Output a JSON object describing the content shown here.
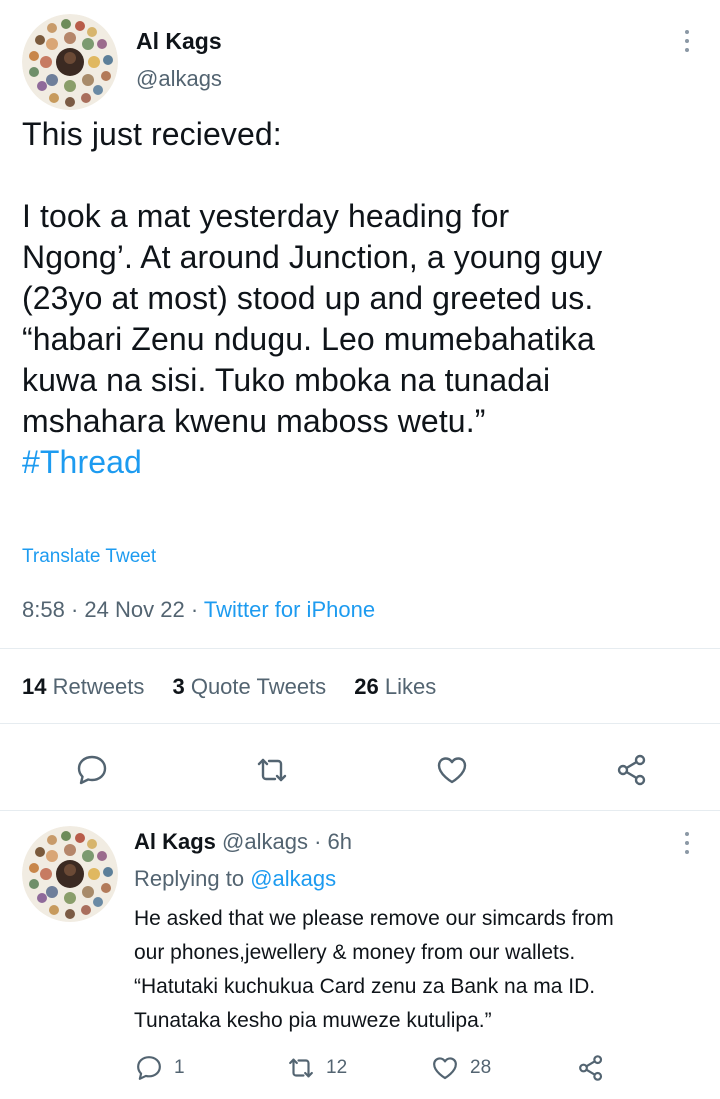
{
  "tweet": {
    "author_name": "Al Kags",
    "author_handle": "@alkags",
    "lines": [
      "This just recieved:",
      "",
      "I took a mat yesterday heading for",
      "Ngong’. At around Junction, a young guy",
      "(23yo at most) stood up and greeted us.",
      "“habari Zenu ndugu. Leo mumebahatika",
      "kuwa na sisi. Tuko mboka na tunadai",
      "mshahara kwenu maboss wetu.”"
    ],
    "hashtag": "#Thread",
    "translate": "Translate Tweet",
    "time": "8:58",
    "date": "24 Nov 22",
    "sep": "·",
    "source": "Twitter for iPhone",
    "stats": {
      "retweets_count": "14",
      "retweets_label": "Retweets",
      "quotes_count": "3",
      "quotes_label": "Quote Tweets",
      "likes_count": "26",
      "likes_label": "Likes"
    }
  },
  "reply": {
    "author_name": "Al Kags",
    "author_handle": "@alkags",
    "age": "· 6h",
    "replying_prefix": "Replying to",
    "replying_to": "@alkags",
    "lines": [
      "He asked that we please remove our simcards from",
      "our phones,jewellery & money from our wallets.",
      "“Hatutaki kuchukua Card zenu za Bank na ma ID.",
      "Tunataka kesho pia muweze kutulipa.”"
    ],
    "reply_count": "1",
    "retweet_count": "12",
    "like_count": "28"
  },
  "colors": {
    "text": "#0f1419",
    "secondary": "#536471",
    "accent": "#1d9bf0",
    "divider": "#e6ecf0"
  },
  "icons": [
    "more-icon",
    "reply-icon",
    "retweet-icon",
    "like-icon",
    "share-icon"
  ]
}
